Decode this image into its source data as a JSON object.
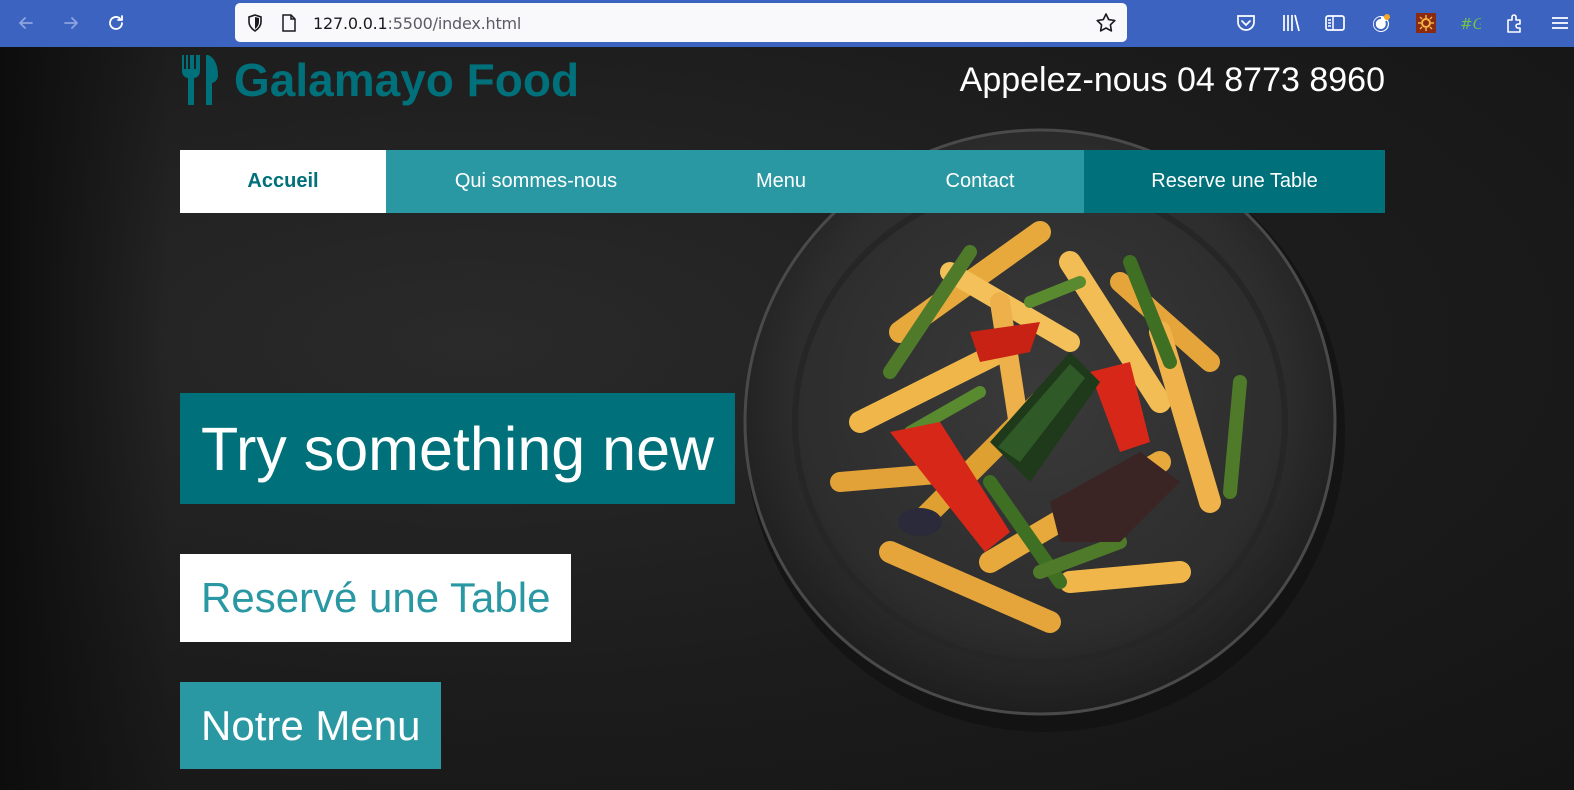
{
  "browser": {
    "url_host": "127.0.0.1",
    "url_rest": ":5500/index.html",
    "toolbar_color": "#3d63c0"
  },
  "icons": {
    "back": "back-arrow-icon",
    "forward": "forward-arrow-icon",
    "reload": "reload-icon",
    "shield": "tracking-protection-shield-icon",
    "page": "page-info-icon",
    "star": "bookmark-star-icon",
    "pocket": "pocket-icon",
    "library": "library-icon",
    "reader": "sidebar-icon",
    "account": "account-sync-icon",
    "ext1": "extension-sun-icon",
    "ext2": "extension-g-icon",
    "extensions": "extensions-puzzle-icon",
    "menu": "hamburger-menu-icon",
    "logo": "fork-knife-icon"
  },
  "header": {
    "brand": "Galamayo Food",
    "phone": "Appelez-nous 04 8773 8960"
  },
  "nav": {
    "home": "Accueil",
    "about": "Qui sommes-nous",
    "menu": "Menu",
    "contact": "Contact",
    "reserve": "Reserve une Table"
  },
  "hero": {
    "title": "Try something new",
    "reserve_button": "Reservé une Table",
    "menu_button": "Notre Menu"
  },
  "colors": {
    "teal_dark": "#00707b",
    "teal_light": "#2a98a3",
    "background": "#1c1c1c"
  }
}
